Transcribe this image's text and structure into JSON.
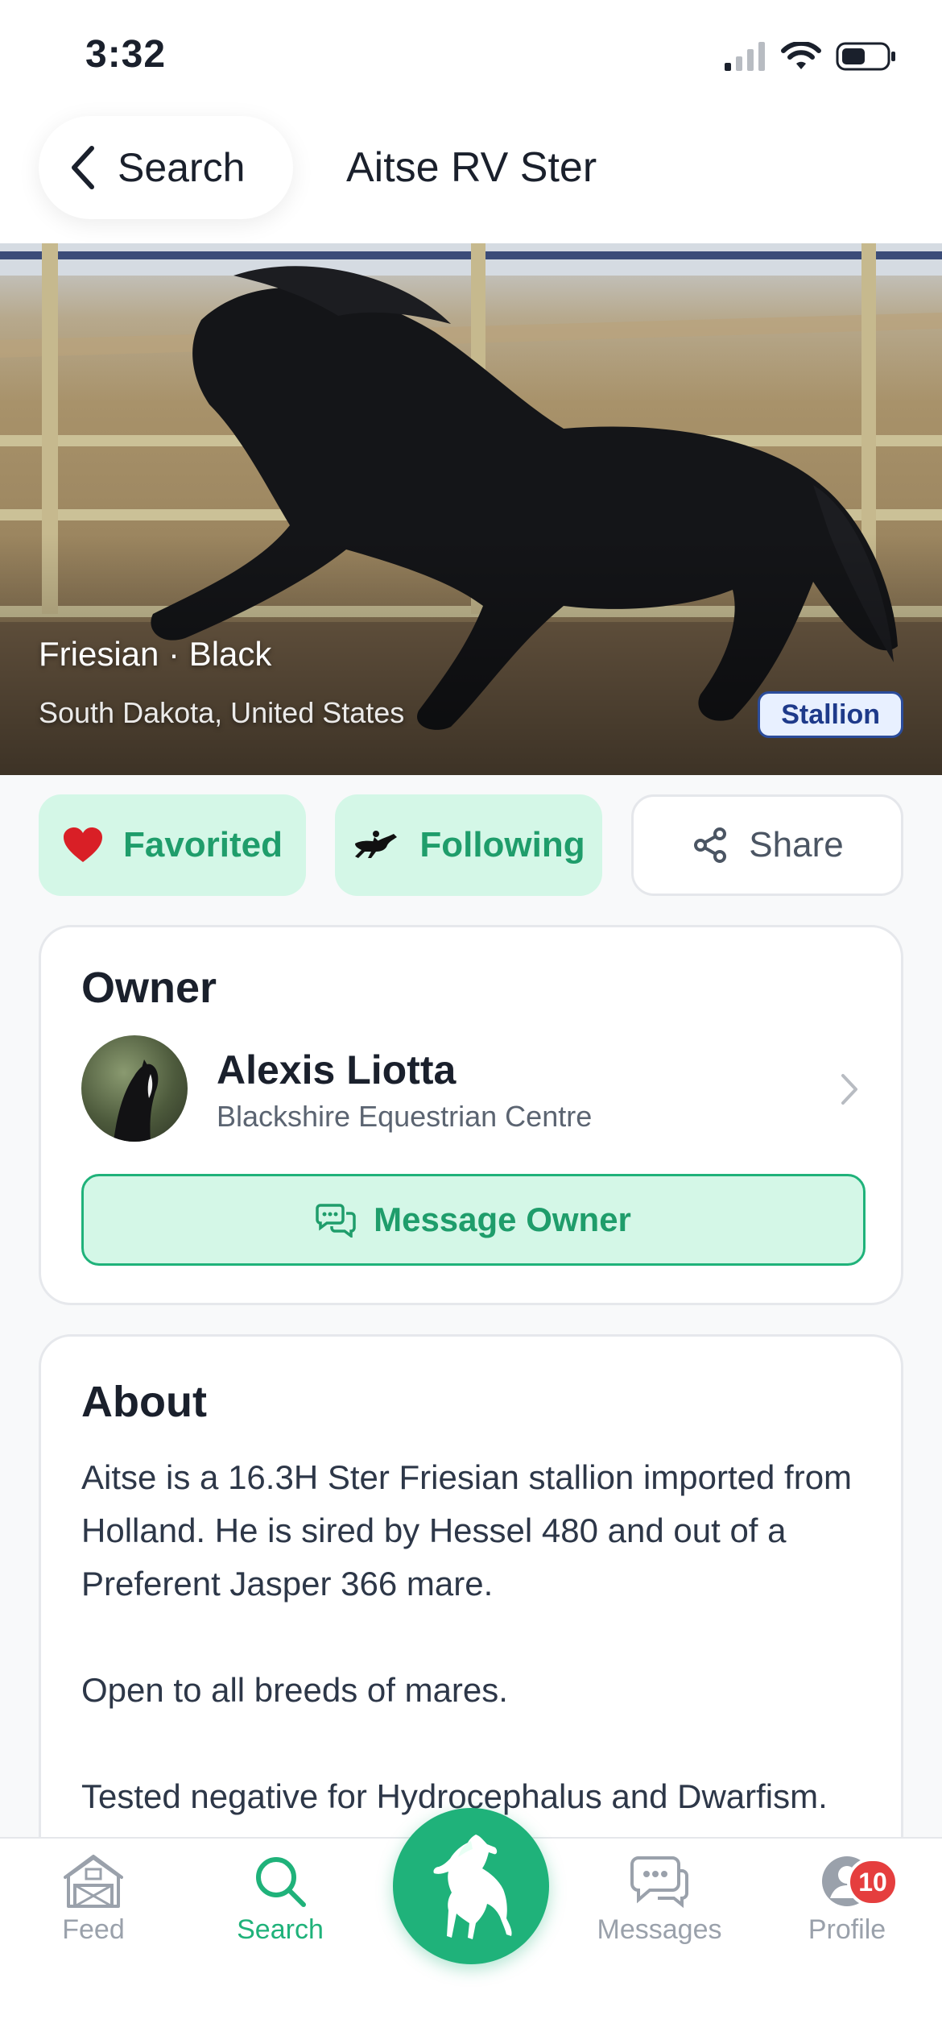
{
  "status_bar": {
    "time": "3:32"
  },
  "header": {
    "back_label": "Search",
    "title": "Aitse RV Ster"
  },
  "hero": {
    "breed_line": "Friesian · Black",
    "location": "South Dakota, United States",
    "badge": "Stallion"
  },
  "actions": {
    "favorite_label": "Favorited",
    "follow_label": "Following",
    "share_label": "Share"
  },
  "owner": {
    "heading": "Owner",
    "name": "Alexis Liotta",
    "farm": "Blackshire Equestrian Centre",
    "message_label": "Message Owner"
  },
  "about": {
    "heading": "About",
    "text": "Aitse is a 16.3H Ster Friesian stallion imported from Holland. He is sired by Hessel 480 and out of a Preferent Jasper 366 mare.\n\nOpen to all breeds of mares.\n\nTested negative for Hydrocephalus and Dwarfism. He"
  },
  "tab_bar": {
    "feed_label": "Feed",
    "search_label": "Search",
    "messages_label": "Messages",
    "profile_label": "Profile",
    "profile_badge": "10"
  },
  "colors": {
    "accent": "#1fb27a",
    "accent_light": "#d4f7e7",
    "badge_red": "#e53e3e",
    "stallion_blue": "#1e3a8a"
  }
}
